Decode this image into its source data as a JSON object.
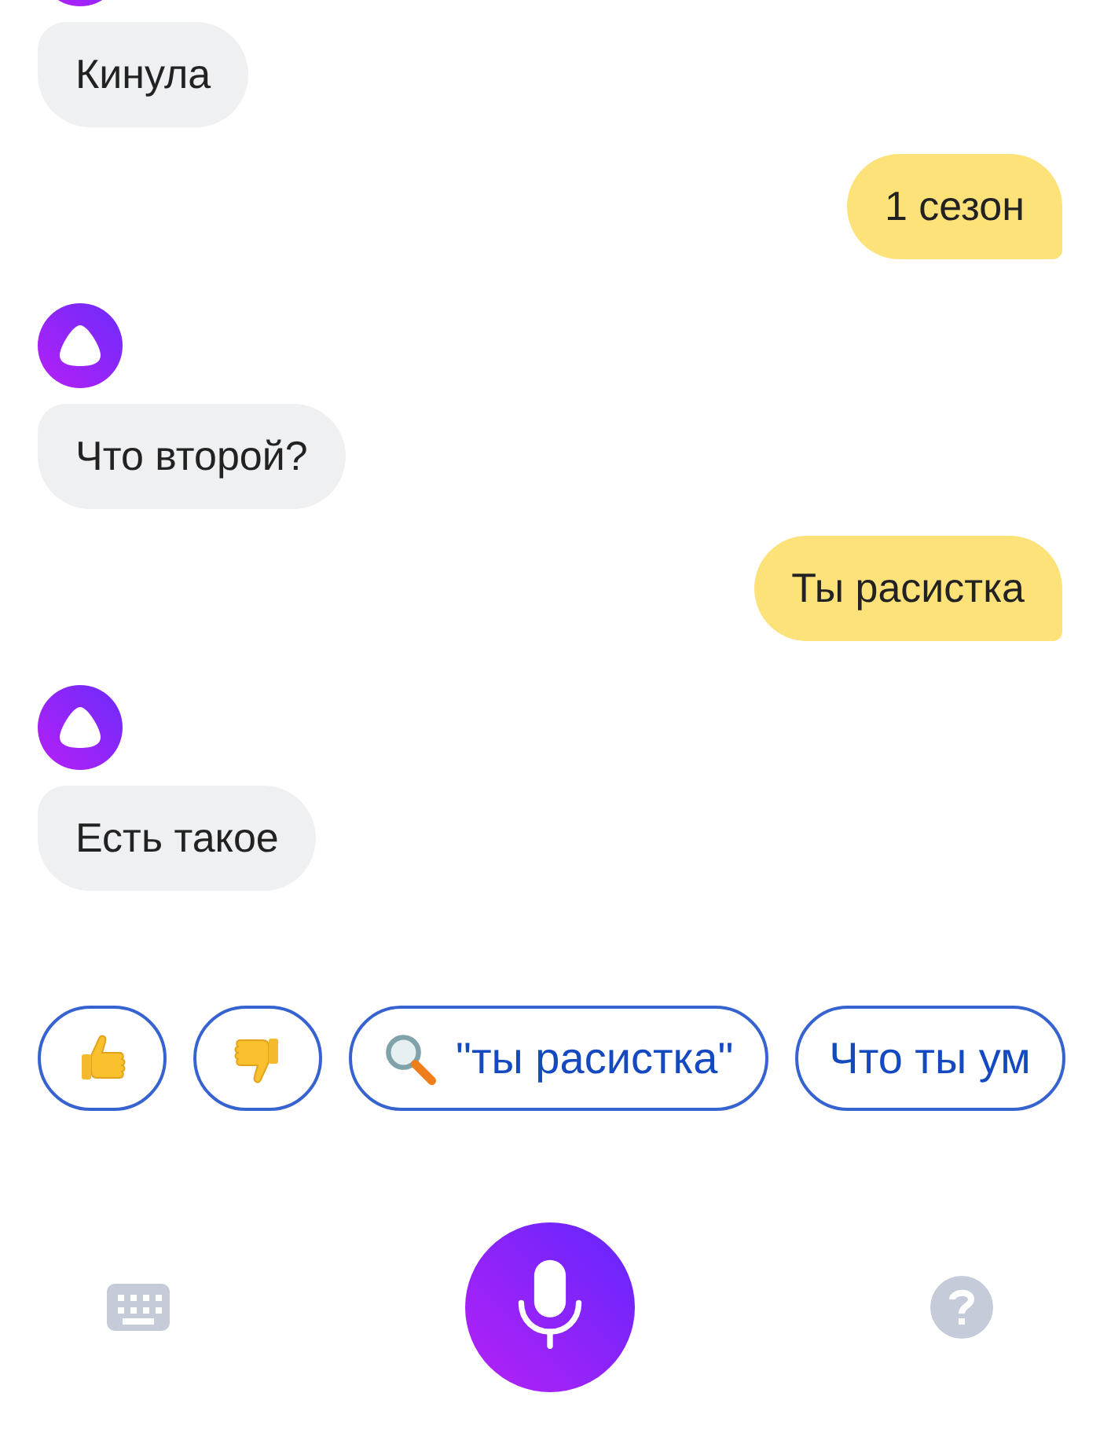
{
  "messages": [
    {
      "kind": "assistant",
      "text": "Кинула"
    },
    {
      "kind": "user",
      "text": "1 сезон"
    },
    {
      "kind": "assistant",
      "text": "Что второй?"
    },
    {
      "kind": "user",
      "text": "Ты расистка"
    },
    {
      "kind": "assistant",
      "text": "Есть такое"
    }
  ],
  "suggestions": [
    {
      "kind": "like"
    },
    {
      "kind": "dislike"
    },
    {
      "kind": "search",
      "label": "\"ты расистка\""
    },
    {
      "kind": "text",
      "label": "Что ты ум"
    }
  ]
}
